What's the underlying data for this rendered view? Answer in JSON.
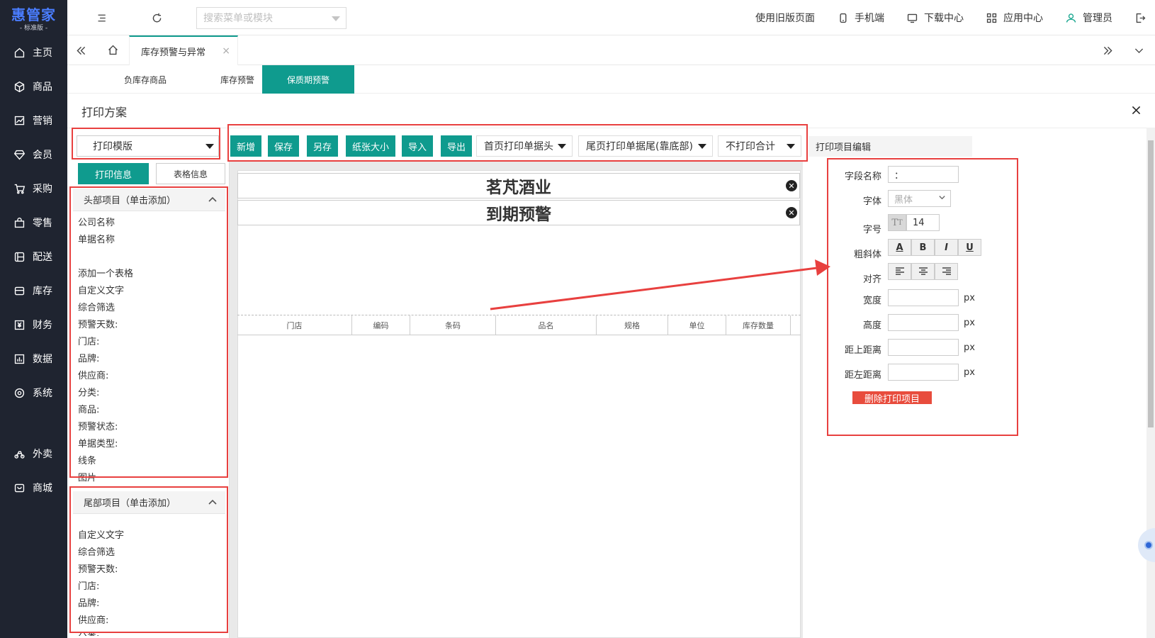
{
  "brand": {
    "name": "惠管家",
    "edition": "- 标准版 -"
  },
  "sidebar": {
    "items": [
      {
        "label": "主页",
        "icon": "home-icon"
      },
      {
        "label": "商品",
        "icon": "box-icon"
      },
      {
        "label": "营销",
        "icon": "chart-icon"
      },
      {
        "label": "会员",
        "icon": "diamond-icon"
      },
      {
        "label": "采购",
        "icon": "cart-icon"
      },
      {
        "label": "零售",
        "icon": "bag-icon"
      },
      {
        "label": "配送",
        "icon": "delivery-icon"
      },
      {
        "label": "库存",
        "icon": "warehouse-icon"
      },
      {
        "label": "财务",
        "icon": "finance-icon"
      },
      {
        "label": "数据",
        "icon": "data-icon"
      },
      {
        "label": "系统",
        "icon": "settings-icon"
      }
    ],
    "extra": [
      {
        "label": "外卖",
        "icon": "takeout-icon"
      },
      {
        "label": "商城",
        "icon": "mall-icon"
      }
    ]
  },
  "topbar": {
    "search_placeholder": "搜索菜单或模块",
    "old_page": "使用旧版页面",
    "mobile": "手机端",
    "download": "下载中心",
    "apps": "应用中心",
    "user": "管理员"
  },
  "tabs": {
    "active": "库存预警与异常",
    "close": "×"
  },
  "subtabs": [
    "负库存商品",
    "库存预警",
    "保质期预警"
  ],
  "dialog": {
    "title": "打印方案"
  },
  "left": {
    "template_select": "打印模版",
    "print_info": "打印信息",
    "table_info": "表格信息",
    "head_title": "头部项目（单击添加）",
    "head_items": [
      "公司名称",
      "单据名称",
      "",
      "添加一个表格",
      "自定义文字",
      "综合筛选",
      "预警天数:",
      "门店:",
      "品牌:",
      "供应商:",
      "分类:",
      "商品:",
      "预警状态:",
      "单据类型:",
      "线条",
      "图片"
    ],
    "foot_title": "尾部项目（单击添加）",
    "foot_items": [
      "自定义文字",
      "综合筛选",
      "预警天数:",
      "门店:",
      "品牌:",
      "供应商:",
      "分类:"
    ]
  },
  "toolbar": {
    "new": "新增",
    "save": "保存",
    "save_as": "另存",
    "paper_size": "纸张大小",
    "import": "导入",
    "export": "导出",
    "first_page_head": "首页打印单据头",
    "last_page_foot": "尾页打印单据尾(靠底部)",
    "no_total": "不打印合计"
  },
  "canvas": {
    "company": "茗芃酒业",
    "doc_name": "到期预警",
    "delete_glyph": "✕",
    "columns": [
      "门店",
      "编码",
      "条码",
      "品名",
      "规格",
      "单位",
      "库存数量"
    ]
  },
  "right": {
    "title": "打印项目编辑",
    "field_name_label": "字段名称",
    "field_name_value": "：",
    "font_label": "字体",
    "font_value": "黑体",
    "size_label": "字号",
    "size_value": "14",
    "style_label": "粗斜体",
    "style_buttons": [
      "A",
      "B",
      "I",
      "U"
    ],
    "align_label": "对齐",
    "width_label": "宽度",
    "height_label": "高度",
    "top_label": "距上距离",
    "left_label": "距左距离",
    "unit": "px",
    "delete": "删除打印项目"
  },
  "colors": {
    "accent": "#0f9b8e",
    "highlight": "#e8403f",
    "sidebar": "#1f2430",
    "danger": "#e84c3d"
  }
}
